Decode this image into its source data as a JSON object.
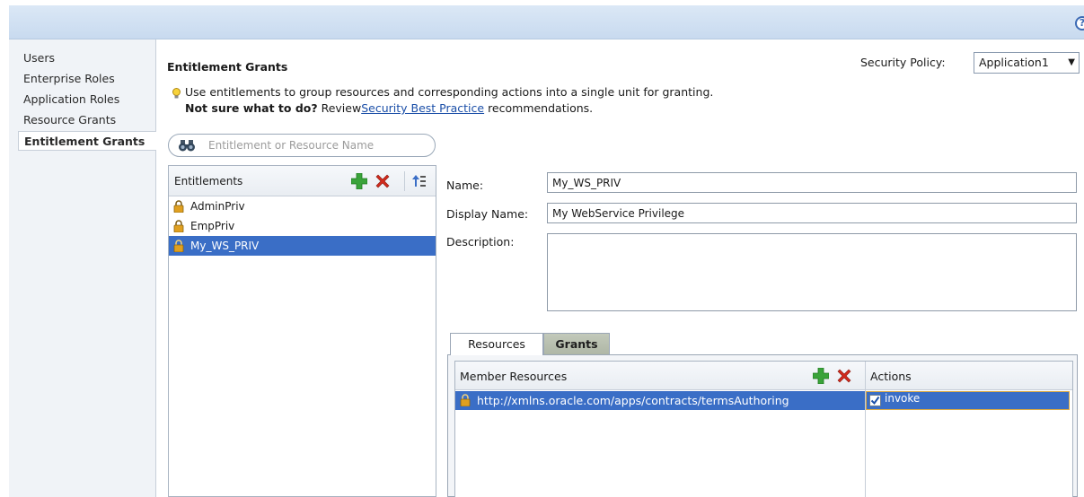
{
  "header": {
    "help_icon": "?"
  },
  "nav": {
    "items": [
      {
        "label": "Users"
      },
      {
        "label": "Enterprise Roles"
      },
      {
        "label": "Application Roles"
      },
      {
        "label": "Resource Grants"
      },
      {
        "label": "Entitlement Grants",
        "active": true
      }
    ]
  },
  "page": {
    "title": "Entitlement Grants",
    "security_policy_label": "Security Policy:",
    "security_policy_value": "Application1",
    "hint_text": "Use entitlements to group resources and corresponding actions into a single unit for granting.",
    "hint_bold": "Not sure what to do?",
    "hint_review": " Review",
    "hint_link": "Security Best Practice",
    "hint_tail": " recommendations."
  },
  "search": {
    "placeholder": "Entitlement or Resource Name"
  },
  "entitlements": {
    "header": "Entitlements",
    "items": [
      {
        "name": "AdminPriv"
      },
      {
        "name": "EmpPriv"
      },
      {
        "name": "My_WS_PRIV",
        "selected": true
      }
    ]
  },
  "details": {
    "name_label": "Name:",
    "name_value": "My_WS_PRIV",
    "display_name_label": "Display Name:",
    "display_name_value": "My WebService Privilege",
    "description_label": "Description:"
  },
  "tabs": {
    "resources": "Resources",
    "grants": "Grants"
  },
  "resources": {
    "col_member": "Member Resources",
    "col_actions": "Actions",
    "row": {
      "resource": "http://xmlns.oracle.com/apps/contracts/termsAuthoring",
      "action": "invoke",
      "checked": true
    }
  },
  "colors": {
    "selection": "#3a6ec6",
    "header_bar": "#c8daef",
    "link": "#1b4fa8",
    "add_icon": "#3aa33a",
    "delete_icon": "#d22a1c",
    "lock_icon": "#e0a020"
  }
}
